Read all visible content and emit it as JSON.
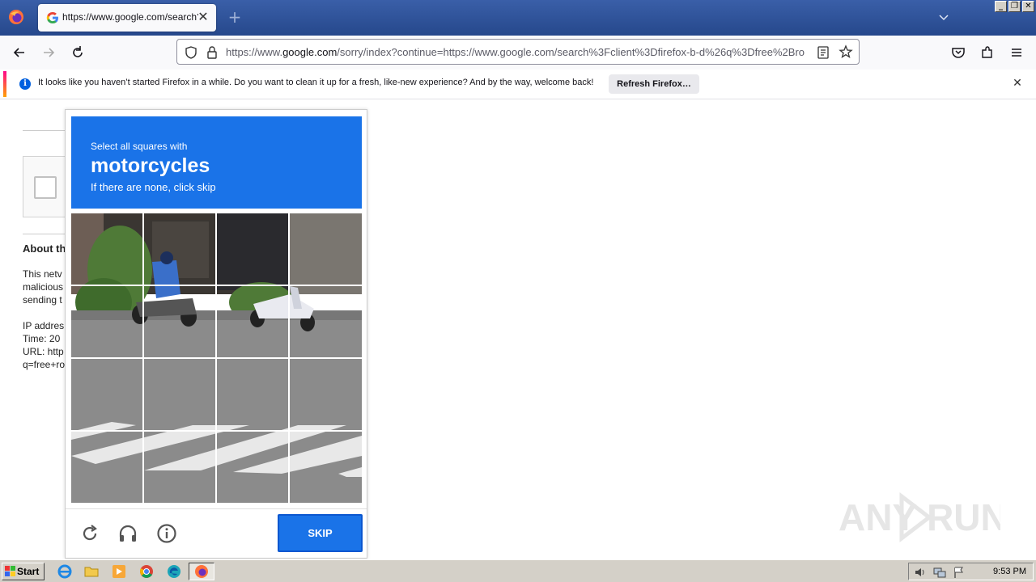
{
  "browser": {
    "tab_title": "https://www.google.com/search?c",
    "url_prefix": "https://www.",
    "url_domain": "google.com",
    "url_rest": "/sorry/index?continue=https://www.google.com/search%3Fclient%3Dfirefox-b-d%26q%3Dfree%2Bro",
    "new_tab_symbol": "+",
    "close_symbol": "✕"
  },
  "window_controls": {
    "minimize": "_",
    "restore": "❐",
    "close": "✕"
  },
  "notification": {
    "info_symbol": "i",
    "text": "It looks like you haven’t started Firefox in a while. Do you want to clean it up for a fresh, like-new experience? And by the way, welcome back!",
    "button_label": "Refresh Firefox…",
    "close_symbol": "✕"
  },
  "page": {
    "about_heading": "About th",
    "body_lines": [
      "This netv",
      "malicious",
      "sending t",
      "",
      "IP addres",
      "Time: 20",
      "URL: http",
      "q=free+ro"
    ]
  },
  "captcha": {
    "instruction": "Select all squares with",
    "target": "motorcycles",
    "hint": "If there are none, click skip",
    "skip_label": "SKIP",
    "footer_icons": [
      "reload-icon",
      "headphones-icon",
      "info-icon"
    ]
  },
  "watermark": {
    "text": "ANY RUN"
  },
  "taskbar": {
    "start_label": "Start",
    "clock": "9:53 PM",
    "apps": [
      "internet-explorer-icon",
      "folder-icon",
      "media-player-icon",
      "chrome-icon",
      "edge-icon",
      "firefox-icon"
    ]
  }
}
